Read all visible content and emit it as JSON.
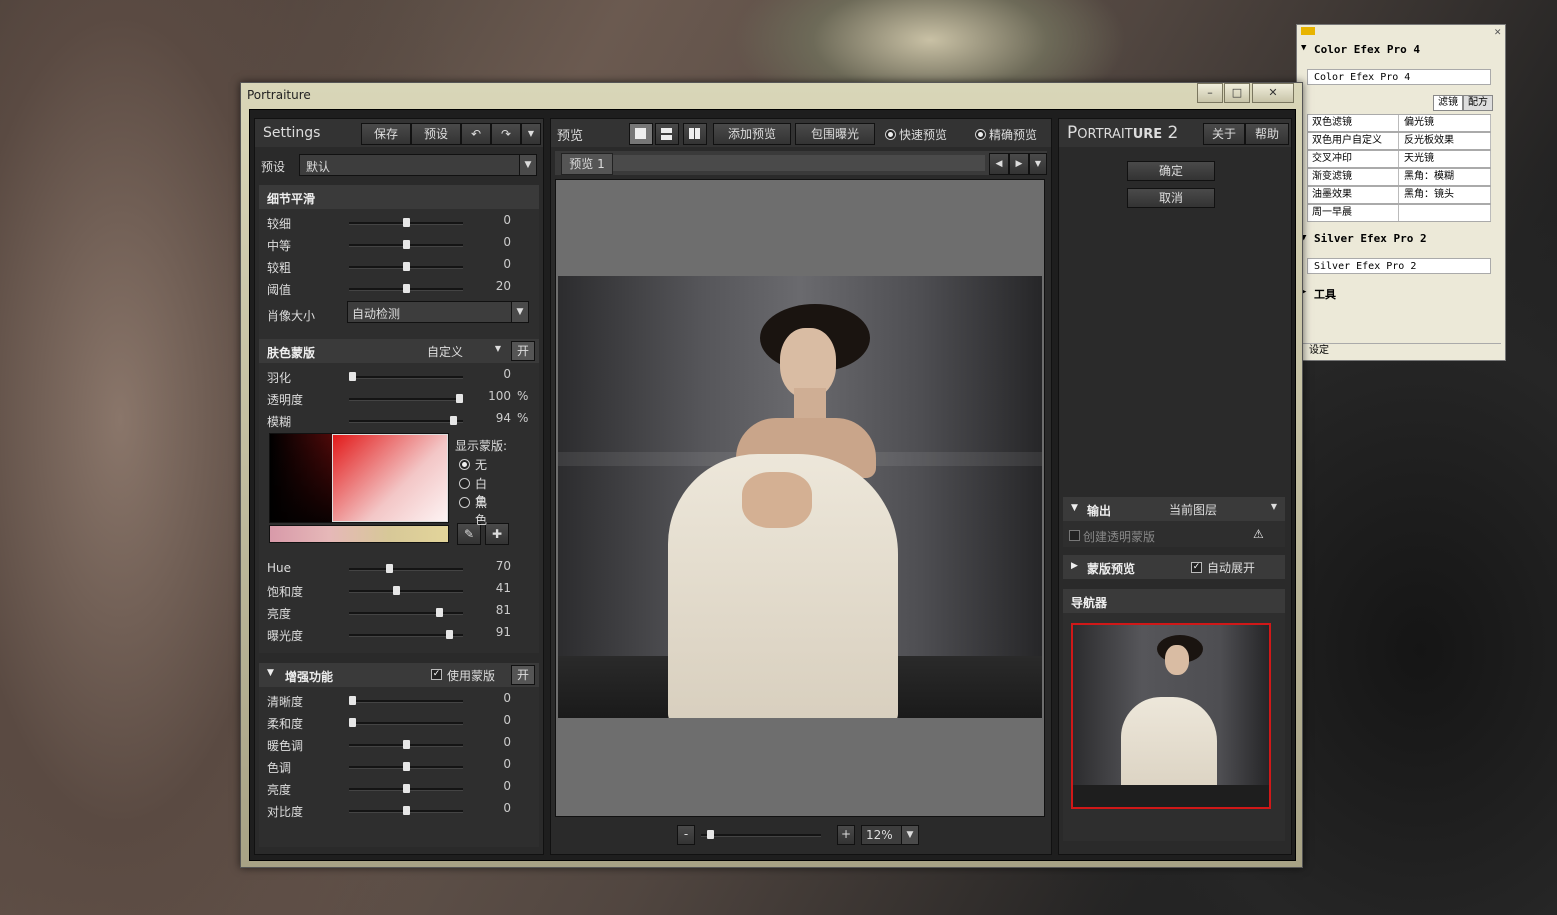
{
  "window": {
    "title": "Portraiture"
  },
  "settings": {
    "title": "Settings",
    "save_label": "保存",
    "preset_label": "预设",
    "preset_row_label": "预设",
    "preset_value": "默认"
  },
  "detail": {
    "title": "细节平滑",
    "sliders": [
      {
        "label": "较细",
        "value": "0",
        "pos": 0.5
      },
      {
        "label": "中等",
        "value": "0",
        "pos": 0.5
      },
      {
        "label": "较粗",
        "value": "0",
        "pos": 0.5
      },
      {
        "label": "阈值",
        "value": "20",
        "pos": 0.5
      }
    ],
    "size_label": "肖像大小",
    "size_value": "自动检测"
  },
  "skin": {
    "title": "肤色蒙版",
    "mode_value": "自定义",
    "toggle": "开",
    "sliders": [
      {
        "label": "羽化",
        "value": "0",
        "unit": "",
        "pos": 0.0
      },
      {
        "label": "透明度",
        "value": "100",
        "unit": "%",
        "pos": 1.0
      },
      {
        "label": "模糊",
        "value": "94",
        "unit": "%",
        "pos": 0.94
      }
    ],
    "show_mask_label": "显示蒙版:",
    "mask_options": [
      "无",
      "白色",
      "黑色"
    ],
    "hsv_sliders": [
      {
        "label": "Hue",
        "value": "70",
        "pos": 0.35
      },
      {
        "label": "饱和度",
        "value": "41",
        "pos": 0.41
      },
      {
        "label": "亮度",
        "value": "81",
        "pos": 0.81
      },
      {
        "label": "曝光度",
        "value": "91",
        "pos": 0.91
      }
    ]
  },
  "enhance": {
    "title": "增强功能",
    "use_mask_label": "使用蒙版",
    "toggle": "开",
    "sliders": [
      {
        "label": "清晰度",
        "value": "0",
        "pos": 0.0
      },
      {
        "label": "柔和度",
        "value": "0",
        "pos": 0.0
      },
      {
        "label": "暖色调",
        "value": "0",
        "pos": 0.5
      },
      {
        "label": "色调",
        "value": "0",
        "pos": 0.5
      },
      {
        "label": "亮度",
        "value": "0",
        "pos": 0.5
      },
      {
        "label": "对比度",
        "value": "0",
        "pos": 0.5
      }
    ]
  },
  "preview": {
    "title": "预览",
    "add_preview": "添加预览",
    "bracket": "包围曝光",
    "fast": "快速预览",
    "precise": "精确预览",
    "tab": "预览 1",
    "zoom_minus": "-",
    "zoom_plus": "+",
    "zoom_value": "12%",
    "zoom_pos": 0.05
  },
  "right": {
    "brand_big": "P",
    "brand_rest1": "ORTRAIT",
    "brand_big2": "URE",
    "brand_ver": " 2",
    "about": "关于",
    "help": "帮助",
    "ok": "确定",
    "cancel": "取消",
    "output_title": "输出",
    "output_value": "当前图层",
    "create_mask": "创建透明蒙版",
    "mask_preview": "蒙版预览",
    "auto_expand": "自动展开",
    "navigator": "导航器"
  },
  "side": {
    "title1": "Color Efex Pro 4",
    "sub1": "Color Efex Pro 4",
    "tab_filter": "滤镜",
    "tab_recipe": "配方",
    "filters": [
      [
        "双色滤镜",
        "偏光镜"
      ],
      [
        "双色用户自定义",
        "反光板效果"
      ],
      [
        "交叉冲印",
        "天光镜"
      ],
      [
        "渐变滤镜",
        "黑角：模糊"
      ],
      [
        "油墨效果",
        "黑角：镜头"
      ],
      [
        "周一早晨",
        ""
      ]
    ],
    "title2": "Silver Efex Pro 2",
    "sub2": "Silver Efex Pro 2",
    "tools": "工具",
    "settings": "设定"
  }
}
